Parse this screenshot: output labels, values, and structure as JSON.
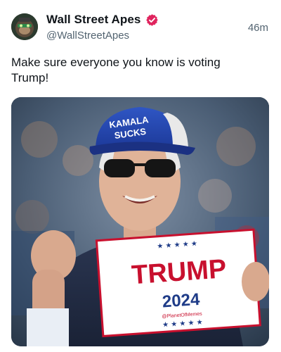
{
  "author": {
    "display_name": "Wall Street Apes",
    "handle": "@WallStreetApes",
    "avatar_icon": "ape-avatar-icon",
    "verified_icon": "verified-badge-icon",
    "verified_color": "#e0245e"
  },
  "timestamp": "46m",
  "post_text": "Make sure everyone you know is voting Trump!",
  "media": {
    "cap_text_line1": "KAMALA",
    "cap_text_line2": "SUCKS",
    "sign_main": "TRUMP",
    "sign_year": "2024",
    "sign_watermark": "@PlanetOfMemes",
    "sign_stars": "★ ★ ★ ★ ★",
    "accent_red": "#c8102e",
    "accent_blue": "#1f3c88"
  }
}
